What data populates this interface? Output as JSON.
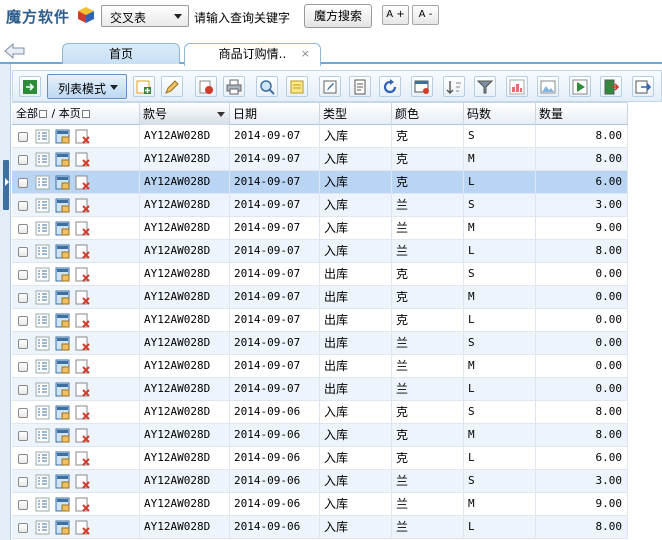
{
  "header": {
    "logo_text": "魔方软件",
    "type_select_value": "交叉表",
    "search_hint": "请输入查询关键字",
    "search_button": "魔方搜索",
    "font_increase": "A +",
    "font_decrease": "A -"
  },
  "tabs": [
    {
      "label": "首页",
      "active": false
    },
    {
      "label": "商品订购情..",
      "active": true,
      "close": "×"
    }
  ],
  "toolbar": {
    "mode_label": "列表模式"
  },
  "grid": {
    "header_select_all": "全部",
    "header_this_page": "/ 本页",
    "columns": [
      "款号",
      "日期",
      "类型",
      "颜色",
      "码数",
      "数量"
    ],
    "rows": [
      {
        "code": "AY12AW028D",
        "date": "2014-09-07",
        "type": "入库",
        "color": "克",
        "size": "S",
        "qty": "8.00"
      },
      {
        "code": "AY12AW028D",
        "date": "2014-09-07",
        "type": "入库",
        "color": "克",
        "size": "M",
        "qty": "8.00"
      },
      {
        "code": "AY12AW028D",
        "date": "2014-09-07",
        "type": "入库",
        "color": "克",
        "size": "L",
        "qty": "6.00"
      },
      {
        "code": "AY12AW028D",
        "date": "2014-09-07",
        "type": "入库",
        "color": "兰",
        "size": "S",
        "qty": "3.00"
      },
      {
        "code": "AY12AW028D",
        "date": "2014-09-07",
        "type": "入库",
        "color": "兰",
        "size": "M",
        "qty": "9.00"
      },
      {
        "code": "AY12AW028D",
        "date": "2014-09-07",
        "type": "入库",
        "color": "兰",
        "size": "L",
        "qty": "8.00"
      },
      {
        "code": "AY12AW028D",
        "date": "2014-09-07",
        "type": "出库",
        "color": "克",
        "size": "S",
        "qty": "0.00"
      },
      {
        "code": "AY12AW028D",
        "date": "2014-09-07",
        "type": "出库",
        "color": "克",
        "size": "M",
        "qty": "0.00"
      },
      {
        "code": "AY12AW028D",
        "date": "2014-09-07",
        "type": "出库",
        "color": "克",
        "size": "L",
        "qty": "0.00"
      },
      {
        "code": "AY12AW028D",
        "date": "2014-09-07",
        "type": "出库",
        "color": "兰",
        "size": "S",
        "qty": "0.00"
      },
      {
        "code": "AY12AW028D",
        "date": "2014-09-07",
        "type": "出库",
        "color": "兰",
        "size": "M",
        "qty": "0.00"
      },
      {
        "code": "AY12AW028D",
        "date": "2014-09-07",
        "type": "出库",
        "color": "兰",
        "size": "L",
        "qty": "0.00"
      },
      {
        "code": "AY12AW028D",
        "date": "2014-09-06",
        "type": "入库",
        "color": "克",
        "size": "S",
        "qty": "8.00"
      },
      {
        "code": "AY12AW028D",
        "date": "2014-09-06",
        "type": "入库",
        "color": "克",
        "size": "M",
        "qty": "8.00"
      },
      {
        "code": "AY12AW028D",
        "date": "2014-09-06",
        "type": "入库",
        "color": "克",
        "size": "L",
        "qty": "6.00"
      },
      {
        "code": "AY12AW028D",
        "date": "2014-09-06",
        "type": "入库",
        "color": "兰",
        "size": "S",
        "qty": "3.00"
      },
      {
        "code": "AY12AW028D",
        "date": "2014-09-06",
        "type": "入库",
        "color": "兰",
        "size": "M",
        "qty": "9.00"
      },
      {
        "code": "AY12AW028D",
        "date": "2014-09-06",
        "type": "入库",
        "color": "兰",
        "size": "L",
        "qty": "8.00"
      }
    ]
  },
  "colors": {
    "accent": "#6aa9dd",
    "selected_row": "#b9d5f3",
    "alt_row": "#eef4fb",
    "logo": "#2b5d8c"
  }
}
